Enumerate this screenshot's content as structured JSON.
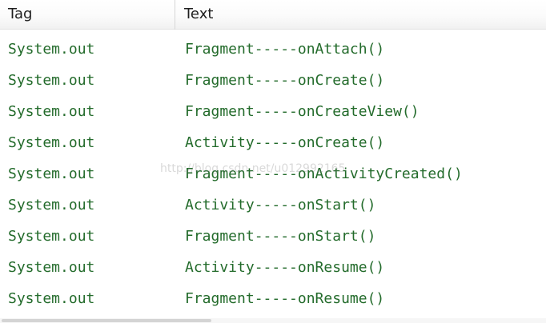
{
  "columns": {
    "tag": "Tag",
    "text": "Text"
  },
  "rows": [
    {
      "tag": "System.out",
      "text": "Fragment-----onAttach()"
    },
    {
      "tag": "System.out",
      "text": "Fragment-----onCreate()"
    },
    {
      "tag": "System.out",
      "text": "Fragment-----onCreateView()"
    },
    {
      "tag": "System.out",
      "text": "Activity-----onCreate()"
    },
    {
      "tag": "System.out",
      "text": "Fragment-----onActivityCreated()"
    },
    {
      "tag": "System.out",
      "text": "Activity-----onStart()"
    },
    {
      "tag": "System.out",
      "text": "Fragment-----onStart()"
    },
    {
      "tag": "System.out",
      "text": "Activity-----onResume()"
    },
    {
      "tag": "System.out",
      "text": "Fragment-----onResume()"
    }
  ],
  "watermark": "http://blog.csdn.net/u012992165",
  "colors": {
    "log_text": "#236b2b",
    "header_text": "#1e1e1e"
  }
}
